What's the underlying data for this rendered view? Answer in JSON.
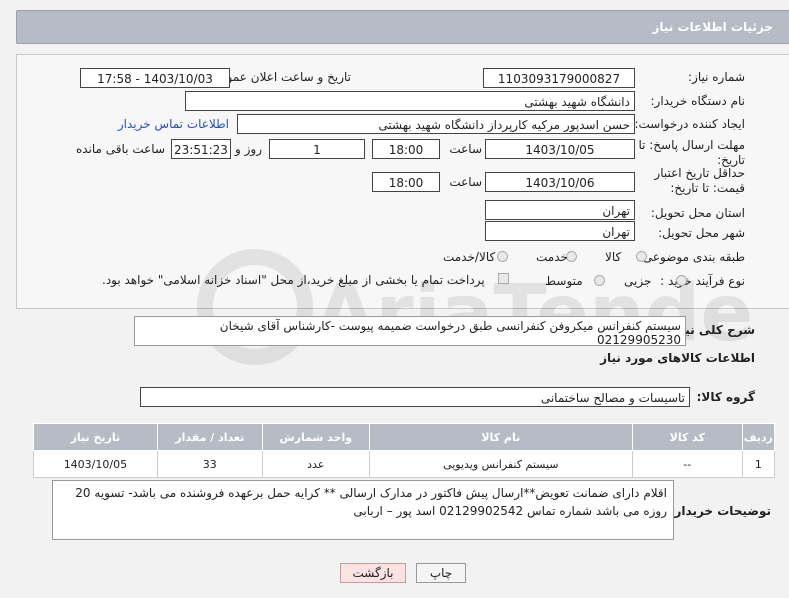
{
  "header": {
    "title": "جزئیات اطلاعات نیاز"
  },
  "need_number": {
    "label": "شماره نیاز:",
    "value": "1103093179000827"
  },
  "announce": {
    "label": "تاریخ و ساعت اعلان عمومی:",
    "value": "1403/10/03 - 17:58"
  },
  "buyer_org": {
    "label": "نام دستگاه خریدار:",
    "value": "دانشگاه شهید بهشتی"
  },
  "creator": {
    "label": "ایجاد کننده درخواست:",
    "value": "حسن اسدپور مرکیه کارپرداز دانشگاه شهید بهشتی",
    "contact_link": "اطلاعات تماس خریدار"
  },
  "deadline": {
    "label": "مهلت ارسال پاسخ: تا تاریخ:",
    "date": "1403/10/05",
    "time_label": "ساعت",
    "time": "18:00",
    "days": "1",
    "days_label": "روز و",
    "remaining": "23:51:23",
    "remaining_label": "ساعت باقی مانده"
  },
  "validity": {
    "label": "حداقل تاریخ اعتبار قیمت: تا تاریخ:",
    "date": "1403/10/06",
    "time_label": "ساعت",
    "time": "18:00"
  },
  "province": {
    "label": "استان محل تحویل:",
    "value": "تهران"
  },
  "city": {
    "label": "شهر محل تحویل:",
    "value": "تهران"
  },
  "category": {
    "label": "طبقه بندی موضوعی:",
    "options": [
      "کالا",
      "خدمت",
      "کالا/خدمت"
    ]
  },
  "process": {
    "label": "نوع فرآیند خرید :",
    "options": [
      "جزیی",
      "متوسط"
    ],
    "payment_note": "پرداخت تمام یا بخشی از مبلغ خرید،از محل \"اسناد خزانه اسلامی\" خواهد بود."
  },
  "description": {
    "label": "شرح کلی نیاز:",
    "value": "سیستم کنفرانس میکروفن کنفرانسی طبق درخواست ضمیمه پیوست -کارشناس آقای شیخان 02129905230"
  },
  "goods_section": {
    "title": "اطلاعات کالاهای مورد نیاز"
  },
  "goods_group": {
    "label": "گروه کالا:",
    "value": "تاسیسات و مصالح ساختمانی"
  },
  "table": {
    "headers": [
      "ردیف",
      "کد کالا",
      "نام کالا",
      "واحد شمارش",
      "تعداد / مقدار",
      "تاریخ نیاز"
    ],
    "rows": [
      [
        "1",
        "--",
        "سیستم کنفرانس ویدیویی",
        "عدد",
        "33",
        "1403/10/05"
      ]
    ]
  },
  "buyer_notes": {
    "label": "توضیحات خریدار:",
    "value": "اقلام دارای ضمانت تعویض**ارسال پیش فاکتور در مدارک ارسالی ** کرایه حمل برعهده فروشنده می باشد- تسویه 20 روزه می باشد شماره تماس 02129902542 اسد پور – اربابی"
  },
  "buttons": {
    "print": "چاپ",
    "back": "بازگشت"
  },
  "watermark": {
    "text": "AriaTender.neT"
  },
  "colors": {
    "header_bg": "#b5bcc6",
    "link": "#2a4fb3",
    "back_button_bg": "#fbe3e3"
  }
}
